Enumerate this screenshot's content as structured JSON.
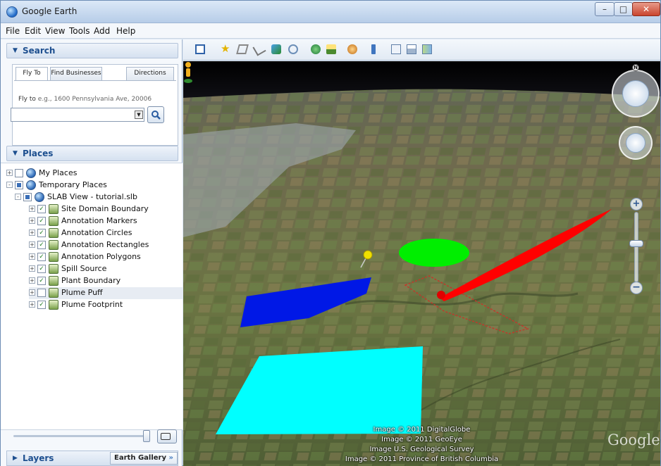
{
  "window": {
    "title": "Google Earth"
  },
  "menu": [
    "File",
    "Edit",
    "View",
    "Tools",
    "Add",
    "Help"
  ],
  "search": {
    "header": "Search",
    "tabs": [
      "Fly To",
      "Find Businesses",
      "Directions"
    ],
    "fly_to_label": "Fly to",
    "fly_to_example": "e.g., 1600 Pennsylvania Ave, 20006",
    "input_value": ""
  },
  "places": {
    "header": "Places",
    "tree": [
      {
        "label": "My Places",
        "level": 0,
        "expander": "+",
        "checked": "off"
      },
      {
        "label": "Temporary Places",
        "level": 0,
        "expander": "-",
        "checked": "partial"
      },
      {
        "label": "SLAB View - tutorial.slb",
        "level": 1,
        "expander": "-",
        "checked": "partial"
      },
      {
        "label": "Site Domain Boundary",
        "level": 2,
        "expander": "+",
        "checked": "on"
      },
      {
        "label": "Annotation Markers",
        "level": 2,
        "expander": "+",
        "checked": "on"
      },
      {
        "label": "Annotation Circles",
        "level": 2,
        "expander": "+",
        "checked": "on"
      },
      {
        "label": "Annotation Rectangles",
        "level": 2,
        "expander": "+",
        "checked": "on"
      },
      {
        "label": "Annotation Polygons",
        "level": 2,
        "expander": "+",
        "checked": "on"
      },
      {
        "label": "Spill Source",
        "level": 2,
        "expander": "+",
        "checked": "on"
      },
      {
        "label": "Plant Boundary",
        "level": 2,
        "expander": "+",
        "checked": "on"
      },
      {
        "label": "Plume Puff",
        "level": 2,
        "expander": "+",
        "checked": "off",
        "selected": true
      },
      {
        "label": "Plume Footprint",
        "level": 2,
        "expander": "+",
        "checked": "on"
      }
    ]
  },
  "layers": {
    "header": "Layers",
    "gallery_button": "Earth Gallery",
    "gallery_arrow": "»"
  },
  "toolbar_icons": [
    "sidebar-toggle-icon",
    "placemark-icon",
    "polygon-icon",
    "path-icon",
    "image-overlay-icon",
    "record-tour-icon",
    "historical-imagery-icon",
    "sunlight-icon",
    "planets-icon",
    "ruler-icon",
    "email-icon",
    "print-icon",
    "view-in-maps-icon"
  ],
  "map": {
    "credits": [
      "Image © 2011 DigitalGlobe",
      "Image © 2011 GeoEye",
      "Image U.S. Geological Survey",
      "Image © 2011 Province of British Columbia"
    ],
    "watermark": "Google",
    "overlay_colors": {
      "rectangle": "#00ffff",
      "polygon": "#0018e6",
      "circle": "#00ee00",
      "plume": "#ff0000",
      "marker": "#f0e000"
    }
  }
}
